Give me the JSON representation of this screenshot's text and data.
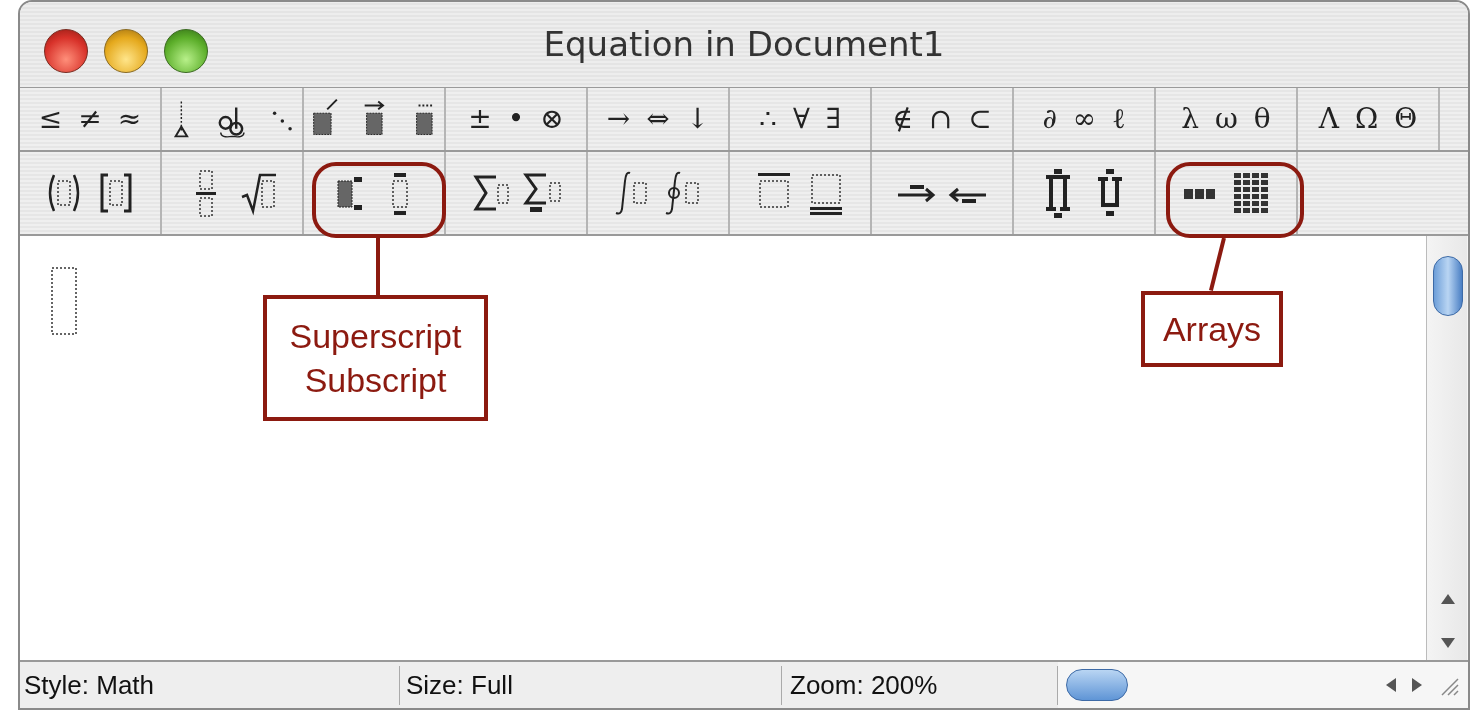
{
  "window": {
    "title": "Equation in Document1"
  },
  "toolbar_row_1": [
    {
      "kind": "symbols",
      "symbols": [
        "≤",
        "≠",
        "≈"
      ]
    },
    {
      "kind": "templates"
    },
    {
      "kind": "templates"
    },
    {
      "kind": "symbols",
      "symbols": [
        "±",
        "•",
        "⊗"
      ]
    },
    {
      "kind": "symbols",
      "symbols": [
        "→",
        "⇔",
        "↓"
      ]
    },
    {
      "kind": "symbols",
      "symbols": [
        "∴",
        "∀",
        "∃"
      ]
    },
    {
      "kind": "symbols",
      "symbols": [
        "∉",
        "∩",
        "⊂"
      ]
    },
    {
      "kind": "symbols",
      "symbols": [
        "∂",
        "∞",
        "ℓ"
      ]
    },
    {
      "kind": "symbols",
      "symbols": [
        "λ",
        "ω",
        "θ"
      ]
    },
    {
      "kind": "symbols",
      "symbols": [
        "Λ",
        "Ω",
        "Θ"
      ]
    }
  ],
  "toolbar_row_2": [
    {
      "kind": "templates"
    },
    {
      "kind": "templates"
    },
    {
      "kind": "templates"
    },
    {
      "kind": "templates"
    },
    {
      "kind": "templates"
    },
    {
      "kind": "templates"
    },
    {
      "kind": "templates"
    },
    {
      "kind": "templates"
    },
    {
      "kind": "templates"
    }
  ],
  "callouts": [
    {
      "lines": [
        "Superscript",
        "Subscript"
      ]
    },
    {
      "lines": [
        "Arrays"
      ]
    }
  ],
  "status_bar": {
    "style": "Style: Math",
    "size": "Size: Full",
    "zoom": "Zoom: 200%"
  }
}
